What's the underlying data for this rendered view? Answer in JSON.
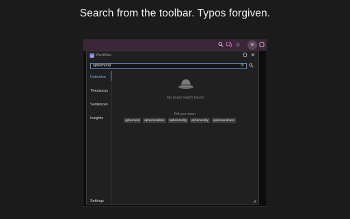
{
  "headline": "Search from the toolbar. Typos forgiven.",
  "browser": {
    "toolbar_icons": [
      "magnifier-icon",
      "devices-icon",
      "star-icon",
      "profile-icon",
      "extensions-icon"
    ],
    "avatar": "W"
  },
  "popup": {
    "app_name": "WordWise",
    "search": {
      "value": "ephemoral"
    },
    "sidebar": {
      "items": [
        {
          "label": "Definition",
          "active": true
        },
        {
          "label": "Thesaurus",
          "active": false
        },
        {
          "label": "Sentences",
          "active": false
        },
        {
          "label": "Insights",
          "active": false
        }
      ],
      "settings": "Settings"
    },
    "content": {
      "no_match": "No exact match found",
      "did_you_mean": "Did you mean:",
      "suggestions": [
        "ephemeral",
        "ephemeralities",
        "ephemerality",
        "ephemerally",
        "ephemeralness"
      ]
    }
  },
  "colors": {
    "accent": "#7e9ee8",
    "toolbar": "#3a2637",
    "background": "#1b1b1b"
  }
}
